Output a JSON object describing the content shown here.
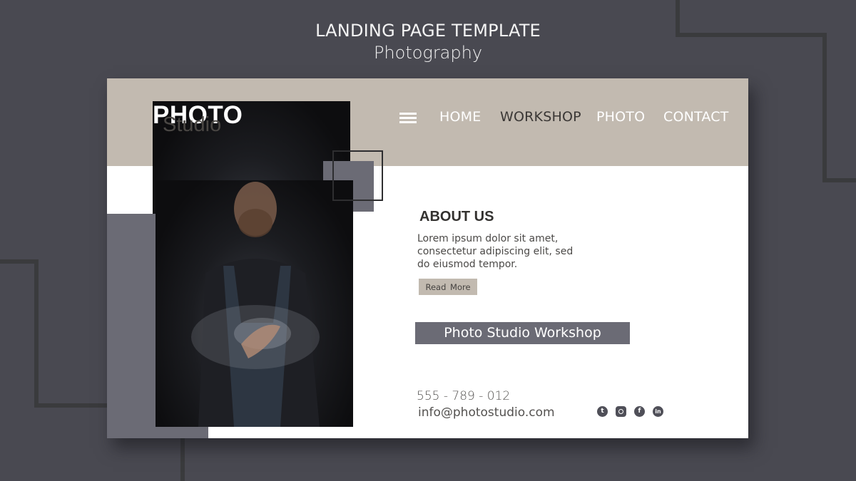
{
  "banner": {
    "title": "LANDING PAGE TEMPLATE",
    "subtitle": "Photography"
  },
  "header": {
    "logo_main": "PHOTO",
    "logo_sub": "Studio",
    "menu_icon": "hamburger-menu-icon",
    "nav": [
      {
        "label": "HOME",
        "active": false
      },
      {
        "label": "WORKSHOP",
        "active": true
      },
      {
        "label": "PHOTO",
        "active": false
      },
      {
        "label": "CONTACT",
        "active": false
      }
    ]
  },
  "hero_image": {
    "description": "Bearded man in dark shirt and denim apron clapping flour-covered hands on a black background"
  },
  "about": {
    "title": "ABOUT US",
    "text": "Lorem ipsum dolor sit amet, consectetur adipiscing elit, sed do eiusmod tempor.",
    "button_label": "Read  More"
  },
  "workshop_banner": "Photo Studio Workshop",
  "contact": {
    "phone": "555 - 789 - 012",
    "email": "info@photostudio.com"
  },
  "socials": [
    {
      "icon": "twitter-icon",
      "glyph": "t"
    },
    {
      "icon": "instagram-icon",
      "glyph": ""
    },
    {
      "icon": "facebook-icon",
      "glyph": "f"
    },
    {
      "icon": "linkedin-icon",
      "glyph": "in"
    }
  ],
  "colors": {
    "background": "#494951",
    "header": "#c2bab0",
    "accent_gray": "#6b6b75",
    "text_dark": "#33312f"
  }
}
